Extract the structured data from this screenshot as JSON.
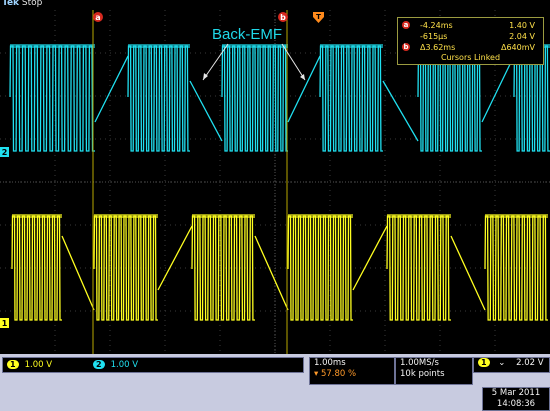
{
  "header": {
    "brand": "Tek",
    "state": "Stop"
  },
  "annotation": {
    "text": "Back-EMF"
  },
  "markers": {
    "cursor_a": "a",
    "cursor_b": "b",
    "trigger_symbol": "T",
    "ch2_ground": "2",
    "ch1_ground": "1"
  },
  "cursor_readout": {
    "a_time": "-4.24ms",
    "a_volt": "1.40 V",
    "b_time": "-615µs",
    "b_volt": "2.04 V",
    "delta_time": "Δ3.62ms",
    "delta_volt": "Δ640mV",
    "status": "Cursors Linked"
  },
  "channels": [
    {
      "number": "1",
      "scale": "1.00 V",
      "color": "#ffff20"
    },
    {
      "number": "2",
      "scale": "1.00 V",
      "color": "#20e0f0"
    }
  ],
  "timebase": {
    "time_per_div": "1.00ms",
    "trigger_position": "57.80 %"
  },
  "acquisition": {
    "sample_rate": "1.00MS/s",
    "record_length": "10k points"
  },
  "trigger": {
    "source": "1",
    "slope_icon": "falling-edge-icon",
    "level": "2.02 V"
  },
  "datetime": {
    "date": "5 Mar 2011",
    "time": "14:08:36"
  },
  "colors": {
    "ch1": "#ffff20",
    "ch2": "#20e0f0",
    "cursor": "#c8c600",
    "screen": "#000000",
    "accent": "#ff8a1c"
  }
}
